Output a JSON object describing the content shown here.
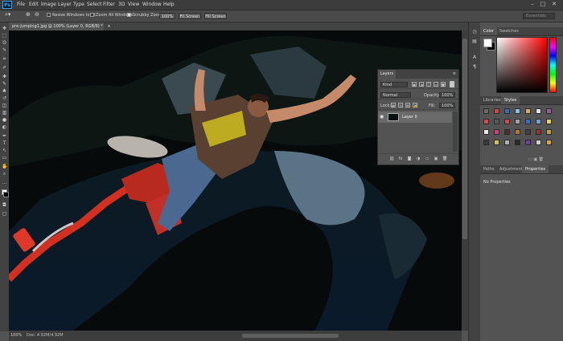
{
  "app": {
    "logo": "Ps"
  },
  "menu": [
    "File",
    "Edit",
    "Image",
    "Layer",
    "Type",
    "Select",
    "Filter",
    "3D",
    "View",
    "Window",
    "Help"
  ],
  "window_controls": [
    "–",
    "□",
    "✕"
  ],
  "options_bar": {
    "resize_windows": "Resize Windows to Fit",
    "zoom_all": "Zoom All Windows",
    "scrubby_zoom": "Scrubby Zoom",
    "btn_100": "100%",
    "btn_fit": "Fit Screen",
    "btn_fill": "Fill Screen",
    "workspace": "Essentials",
    "resize_checked": false,
    "zoom_all_checked": false,
    "scrubby_checked": true
  },
  "document": {
    "tab_title": "pre-Jumping1.jpg @ 100% (Layer 0, RGB/8) *",
    "tab_close": "×",
    "zoom": "100%",
    "info": "Doc: 4.92M/4.92M"
  },
  "tools": [
    "move-icon",
    "marquee-icon",
    "lasso-icon",
    "quick-select-icon",
    "crop-icon",
    "eyedropper-icon",
    "healing-icon",
    "brush-icon",
    "stamp-icon",
    "history-brush-icon",
    "eraser-icon",
    "gradient-icon",
    "blur-icon",
    "dodge-icon",
    "pen-icon",
    "type-icon",
    "path-select-icon",
    "shape-icon",
    "hand-icon",
    "zoom-icon",
    "more-icon"
  ],
  "tool_glyphs": [
    "✥",
    "⬚",
    "ʘ",
    "✎",
    "⌗",
    "✐",
    "✚",
    "✎",
    "♣",
    "↺",
    "◫",
    "▥",
    "●",
    "◐",
    "✒",
    "T",
    "↖",
    "▭",
    "✋",
    "⌕",
    "…"
  ],
  "layers_panel": {
    "tab": "Layers",
    "kind": "Kind",
    "blend_mode": "Normal",
    "opacity_label": "Opacity:",
    "opacity": "100%",
    "lock_label": "Lock:",
    "fill_label": "Fill:",
    "fill": "100%",
    "layer_name": "Layer 0",
    "footer_icons": [
      "link-icon",
      "fx-icon",
      "mask-icon",
      "adjustment-icon",
      "group-icon",
      "new-layer-icon",
      "delete-icon"
    ],
    "footer_glyphs": [
      "⛓",
      "fx",
      "◙",
      "◑",
      "▭",
      "▣",
      "🗑"
    ]
  },
  "color_panel": {
    "tabs": [
      "Color",
      "Swatches"
    ],
    "fg": "#ffffff",
    "bg": "#000000"
  },
  "libraries_panel": {
    "tabs": [
      "Libraries",
      "Styles"
    ]
  },
  "properties_panel": {
    "tabs": [
      "Paths",
      "Adjustments",
      "Properties"
    ],
    "empty": "No Properties"
  },
  "styles_swatches": [
    "#6a6a6a",
    "#c84848",
    "#3a6ab0",
    "#8ac0e8",
    "#d0b060",
    "#e0e0e0",
    "#9a5aa0",
    "#d04c4c",
    "#5a5a5a",
    "#c85050",
    "#a0a0a0",
    "#3070c0",
    "#70a0d0",
    "#e8d060",
    "#e8e8e8",
    "#d04080",
    "#5a2a2a",
    "#b07838",
    "#404040",
    "#a03030",
    "#c0a040",
    "#3a3a3a",
    "#d0c060",
    "#b0b0b0",
    "#2a2a2a",
    "#7040a0",
    "#d0d0d0",
    "#e0a040"
  ],
  "colors": {
    "accent": "#31a8ff",
    "panel": "#535353",
    "dark": "#424242"
  }
}
